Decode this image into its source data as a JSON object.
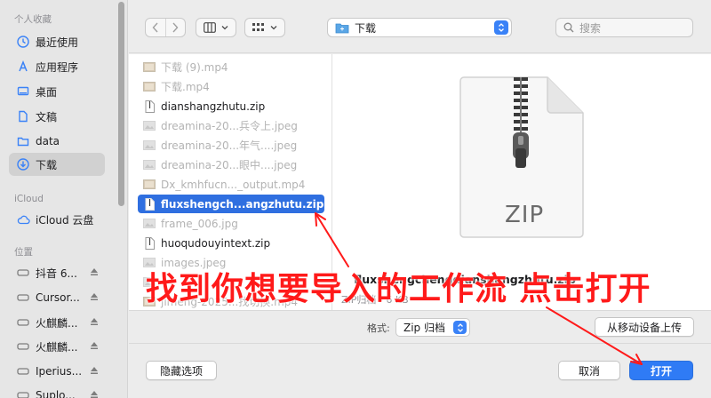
{
  "sidebar": {
    "favorites_header": "个人收藏",
    "favorites": [
      {
        "label": "最近使用",
        "icon": "clock-icon"
      },
      {
        "label": "应用程序",
        "icon": "applications-icon"
      },
      {
        "label": "桌面",
        "icon": "desktop-icon"
      },
      {
        "label": "文稿",
        "icon": "document-icon"
      },
      {
        "label": "data",
        "icon": "folder-icon"
      },
      {
        "label": "下载",
        "icon": "download-icon",
        "active": true
      }
    ],
    "icloud_header": "iCloud",
    "icloud": [
      {
        "label": "iCloud 云盘",
        "icon": "cloud-icon"
      }
    ],
    "locations_header": "位置",
    "locations": [
      {
        "label": "抖音 6...",
        "icon": "drive-icon"
      },
      {
        "label": "Cursor...",
        "icon": "drive-icon"
      },
      {
        "label": "火麒麟...",
        "icon": "drive-icon"
      },
      {
        "label": "火麒麟...",
        "icon": "drive-icon"
      },
      {
        "label": "Iperius...",
        "icon": "drive-icon"
      },
      {
        "label": "Suplo...",
        "icon": "drive-icon"
      }
    ]
  },
  "toolbar": {
    "location": "下载",
    "search_placeholder": "搜索"
  },
  "files": [
    {
      "name": "下载 (9).mp4",
      "type": "video",
      "enabled": false
    },
    {
      "name": "下载.mp4",
      "type": "video",
      "enabled": false
    },
    {
      "name": "dianshangzhutu.zip",
      "type": "doc",
      "enabled": true
    },
    {
      "name": "dreamina-20...兵令上.jpeg",
      "type": "image",
      "enabled": false
    },
    {
      "name": "dreamina-20...年气....jpeg",
      "type": "image",
      "enabled": false
    },
    {
      "name": "dreamina-20...眼中....jpeg",
      "type": "image",
      "enabled": false
    },
    {
      "name": "Dx_kmhfucn..._output.mp4",
      "type": "video",
      "enabled": false
    },
    {
      "name": "fluxshengch...angzhutu.zip",
      "type": "doc",
      "enabled": true,
      "selected": true
    },
    {
      "name": "frame_006.jpg",
      "type": "image",
      "enabled": false
    },
    {
      "name": "huoqudouyintext.zip",
      "type": "doc",
      "enabled": true
    },
    {
      "name": "images.jpeg",
      "type": "image",
      "enabled": false
    },
    {
      "name": "",
      "type": "image",
      "enabled": false
    },
    {
      "name": "jimeng-2025...找切换.mp4",
      "type": "video",
      "enabled": false
    }
  ],
  "preview": {
    "badge": "ZIP",
    "name": "fluxshengchengdianshangzhutu.zip",
    "meta": "ZIP归档 - 6 KB"
  },
  "format": {
    "label": "格式:",
    "value": "Zip 归档"
  },
  "buttons": {
    "upload": "从移动设备上传",
    "hide_options": "隐藏选项",
    "cancel": "取消",
    "open": "打开"
  },
  "annotation": {
    "text": "找到你想要导入的工作流 点击打开",
    "color": "#ff1a1a"
  },
  "colors": {
    "accent": "#2f7bf5",
    "selection": "#2f6fe0"
  }
}
